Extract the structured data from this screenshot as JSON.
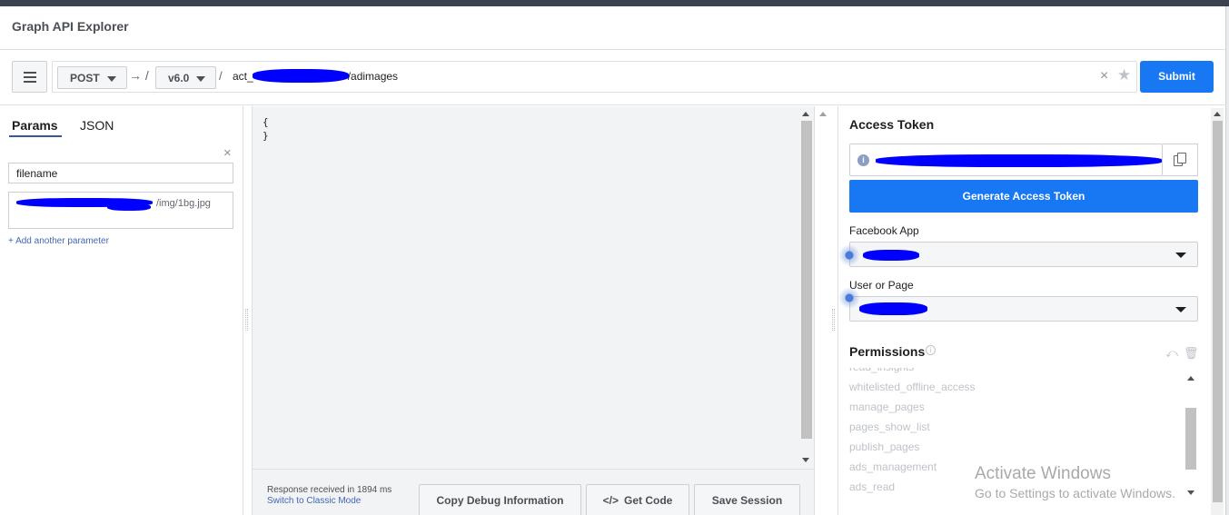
{
  "app": {
    "title": "Graph API Explorer"
  },
  "url_bar": {
    "method": "POST",
    "arrow": "→ /",
    "version": "v6.0",
    "slash": "/",
    "path_prefix": "act_",
    "path_suffix": "/adimages",
    "clear": "×",
    "star": "★",
    "submit_label": "Submit"
  },
  "params_panel": {
    "tabs": [
      {
        "label": "Params",
        "active": true
      },
      {
        "label": "JSON",
        "active": false
      }
    ],
    "remove_symbol": "×",
    "param_name": "filename",
    "param_value_visible": "/img/1bg.jpg",
    "add_param_label": "+ Add another parameter"
  },
  "response": {
    "body": "{\n}",
    "status_text": "Response received in 1894 ms",
    "classic_mode_link": "Switch to Classic Mode",
    "buttons": {
      "copy_debug": "Copy Debug Information",
      "get_code": "Get Code",
      "get_code_icon": "</>",
      "save_session": "Save Session"
    }
  },
  "access_panel": {
    "title": "Access Token",
    "info_icon": "i",
    "generate_label": "Generate Access Token",
    "facebook_app_label": "Facebook App",
    "user_or_page_label": "User or Page",
    "permissions_title": "Permissions",
    "permissions_info_icon": "i",
    "undo_icon": "⤺",
    "trash_icon": "🗑",
    "permissions": [
      "read_insights",
      "whitelisted_offline_access",
      "manage_pages",
      "pages_show_list",
      "publish_pages",
      "ads_management",
      "ads_read"
    ]
  },
  "watermark": {
    "line1": "Activate Windows",
    "line2": "Go to Settings to activate Windows."
  },
  "colors": {
    "accent": "#1877f2",
    "link": "#4267b2",
    "redaction": "#0000ff"
  }
}
